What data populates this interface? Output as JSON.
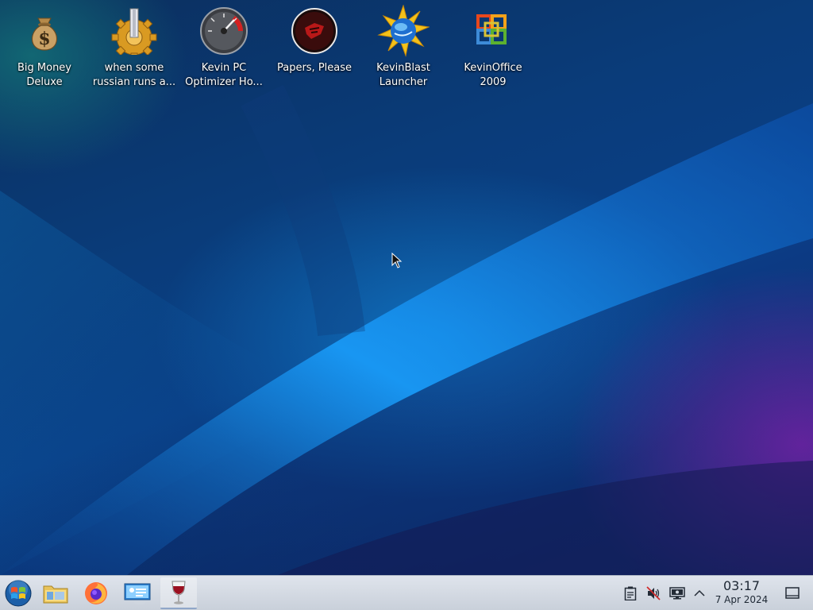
{
  "desktop": {
    "icons": [
      {
        "label": "Big Money\nDeluxe",
        "icon": "money-bag-icon"
      },
      {
        "label": "when some\nrussian runs a...",
        "icon": "gear-icon"
      },
      {
        "label": "Kevin PC\nOptimizer Ho...",
        "icon": "speedometer-icon"
      },
      {
        "label": "Papers, Please",
        "icon": "papers-please-icon"
      },
      {
        "label": "KevinBlast\nLauncher",
        "icon": "globe-burst-icon"
      },
      {
        "label": "KevinOffice\n2009",
        "icon": "office-logo-icon"
      }
    ]
  },
  "taskbar": {
    "launchers": [
      {
        "name": "start-menu",
        "icon": "windows-orb-icon"
      },
      {
        "name": "file-manager",
        "icon": "folder-icon"
      },
      {
        "name": "firefox",
        "icon": "firefox-icon"
      },
      {
        "name": "remote-desktop",
        "icon": "monitor-user-icon"
      },
      {
        "name": "wine",
        "icon": "wine-glass-icon",
        "active": true
      }
    ],
    "tray": [
      {
        "name": "clipboard",
        "icon": "clipboard-icon"
      },
      {
        "name": "volume",
        "icon": "muted-speaker-icon"
      },
      {
        "name": "network",
        "icon": "display-network-icon"
      },
      {
        "name": "expand",
        "icon": "chevron-up-icon"
      }
    ],
    "clock": {
      "time": "03:17",
      "date": "7 Apr 2024"
    },
    "show_desktop_icon": "show-desktop-icon"
  },
  "colors": {
    "panel": "#d6dce5",
    "wallpaper_blue": "#0a3f86",
    "wallpaper_purple": "#8c1aa6"
  }
}
